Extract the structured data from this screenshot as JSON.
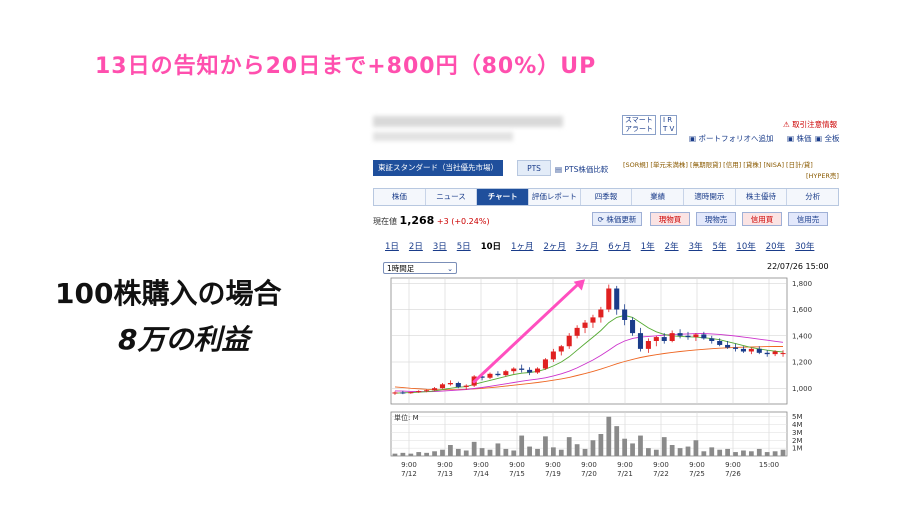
{
  "headline": "13日の告知から20日まで+800円（80%）UP",
  "caption1": "100株購入の場合",
  "caption2": "8万の利益",
  "toolbar": {
    "smart_alert": "スマート",
    "smart_alert2": "アラート",
    "ir": "I R",
    "tv": "T V",
    "risk_info": "取引注意情報",
    "portfolio_add": "ポートフォリオへ追加",
    "stock_board": "株価",
    "full_board": "全板"
  },
  "market": {
    "label": "東証スタンダード（当社優先市場）",
    "pts": "PTS",
    "pts_compare": "PTS株価比較",
    "badges_line1": "[SOR規] [単元未満株] [無期限貸] [信用] [貸株] [NISA] [日計/貸]",
    "badges_line2": "[HYPER売]"
  },
  "nav_tabs": [
    "株価",
    "ニュース",
    "チャート",
    "評価レポート",
    "四季報",
    "業績",
    "適時開示",
    "株主優待",
    "分析"
  ],
  "active_tab": "チャート",
  "quote": {
    "label": "現在値",
    "price": "1,268",
    "change": "+3 (+0.24%)"
  },
  "action_buttons": {
    "refresh": "株価更新",
    "spot_buy": "現物買",
    "spot_sell": "現物売",
    "margin_buy": "信用買",
    "margin_sell": "信用売"
  },
  "periods": [
    "1日",
    "2日",
    "3日",
    "5日",
    "10日",
    "1ヶ月",
    "2ヶ月",
    "3ヶ月",
    "6ヶ月",
    "1年",
    "2年",
    "3年",
    "5年",
    "10年",
    "20年",
    "30年"
  ],
  "selected_period": "10日",
  "interval_select": "1時間足",
  "timestamp": "22/07/26 15:00",
  "chart_data": {
    "type": "candlestick",
    "price_axis": {
      "ticks": [
        1000,
        1200,
        1400,
        1600,
        1800
      ],
      "ylim": [
        880,
        1840
      ]
    },
    "volume_axis": {
      "unit_label": "単位: M",
      "ticks": [
        "1M",
        "2M",
        "3M",
        "4M",
        "5M"
      ],
      "ylim": [
        0,
        5.6
      ]
    },
    "x_time_labels": [
      "9:00",
      "9:00",
      "9:00",
      "9:00",
      "9:00",
      "9:00",
      "9:00",
      "9:00",
      "9:00",
      "9:00",
      "15:00"
    ],
    "x_date_labels": [
      "7/12",
      "7/13",
      "7/14",
      "7/15",
      "7/19",
      "7/20",
      "7/21",
      "7/22",
      "7/25",
      "7/26",
      ""
    ],
    "candles": [
      [
        960,
        975,
        950,
        968
      ],
      [
        968,
        980,
        955,
        962
      ],
      [
        962,
        972,
        958,
        970
      ],
      [
        970,
        985,
        965,
        978
      ],
      [
        978,
        990,
        970,
        985
      ],
      [
        985,
        1010,
        980,
        1000
      ],
      [
        1000,
        1040,
        995,
        1030
      ],
      [
        1030,
        1060,
        1020,
        1040
      ],
      [
        1040,
        1050,
        1000,
        1010
      ],
      [
        1010,
        1030,
        990,
        1020
      ],
      [
        1020,
        1100,
        1010,
        1090
      ],
      [
        1090,
        1110,
        1060,
        1080
      ],
      [
        1080,
        1120,
        1070,
        1110
      ],
      [
        1110,
        1130,
        1090,
        1100
      ],
      [
        1100,
        1140,
        1090,
        1130
      ],
      [
        1130,
        1160,
        1110,
        1150
      ],
      [
        1150,
        1180,
        1120,
        1140
      ],
      [
        1140,
        1160,
        1100,
        1120
      ],
      [
        1120,
        1160,
        1110,
        1150
      ],
      [
        1150,
        1230,
        1140,
        1220
      ],
      [
        1220,
        1300,
        1200,
        1280
      ],
      [
        1280,
        1330,
        1250,
        1320
      ],
      [
        1320,
        1420,
        1300,
        1400
      ],
      [
        1400,
        1480,
        1380,
        1460
      ],
      [
        1460,
        1520,
        1420,
        1500
      ],
      [
        1500,
        1560,
        1460,
        1540
      ],
      [
        1540,
        1620,
        1500,
        1600
      ],
      [
        1600,
        1790,
        1580,
        1760
      ],
      [
        1760,
        1780,
        1560,
        1600
      ],
      [
        1600,
        1640,
        1480,
        1520
      ],
      [
        1520,
        1540,
        1400,
        1420
      ],
      [
        1420,
        1460,
        1280,
        1300
      ],
      [
        1300,
        1380,
        1270,
        1360
      ],
      [
        1360,
        1400,
        1320,
        1390
      ],
      [
        1390,
        1420,
        1340,
        1360
      ],
      [
        1360,
        1440,
        1350,
        1420
      ],
      [
        1420,
        1450,
        1380,
        1400
      ],
      [
        1400,
        1430,
        1370,
        1390
      ],
      [
        1390,
        1420,
        1360,
        1410
      ],
      [
        1410,
        1430,
        1370,
        1380
      ],
      [
        1380,
        1400,
        1340,
        1360
      ],
      [
        1360,
        1380,
        1320,
        1330
      ],
      [
        1330,
        1360,
        1300,
        1310
      ],
      [
        1310,
        1340,
        1280,
        1300
      ],
      [
        1300,
        1320,
        1270,
        1280
      ],
      [
        1280,
        1310,
        1260,
        1300
      ],
      [
        1300,
        1320,
        1260,
        1270
      ],
      [
        1270,
        1290,
        1240,
        1260
      ],
      [
        1260,
        1290,
        1245,
        1280
      ],
      [
        1265,
        1290,
        1240,
        1268
      ]
    ],
    "ma_short": [
      962,
      965,
      967,
      970,
      974,
      980,
      990,
      1000,
      1008,
      1012,
      1030,
      1045,
      1060,
      1075,
      1090,
      1105,
      1115,
      1120,
      1128,
      1145,
      1170,
      1200,
      1240,
      1290,
      1340,
      1390,
      1440,
      1500,
      1540,
      1555,
      1540,
      1500,
      1460,
      1430,
      1410,
      1400,
      1395,
      1392,
      1390,
      1385,
      1378,
      1370,
      1355,
      1340,
      1325,
      1310,
      1300,
      1290,
      1282,
      1276
    ],
    "ma_mid": [
      980,
      978,
      976,
      975,
      974,
      975,
      978,
      982,
      986,
      990,
      998,
      1006,
      1015,
      1024,
      1034,
      1044,
      1054,
      1062,
      1070,
      1080,
      1094,
      1110,
      1130,
      1155,
      1185,
      1215,
      1250,
      1290,
      1330,
      1360,
      1380,
      1390,
      1395,
      1400,
      1405,
      1410,
      1412,
      1414,
      1416,
      1416,
      1414,
      1410,
      1404,
      1398,
      1390,
      1382,
      1374,
      1366,
      1358,
      1350
    ],
    "ma_long": [
      1010,
      1005,
      1000,
      996,
      992,
      990,
      989,
      989,
      990,
      992,
      995,
      999,
      1004,
      1010,
      1016,
      1023,
      1030,
      1037,
      1044,
      1052,
      1061,
      1071,
      1083,
      1097,
      1112,
      1128,
      1146,
      1166,
      1186,
      1204,
      1220,
      1234,
      1246,
      1256,
      1265,
      1273,
      1280,
      1286,
      1292,
      1297,
      1301,
      1305,
      1308,
      1311,
      1313,
      1315,
      1316,
      1317,
      1318,
      1318
    ],
    "volumes": [
      0.3,
      0.4,
      0.3,
      0.5,
      0.4,
      0.6,
      0.8,
      1.4,
      0.9,
      0.7,
      1.8,
      1.0,
      0.8,
      1.6,
      0.9,
      0.7,
      2.6,
      1.2,
      0.9,
      2.5,
      1.1,
      0.8,
      2.4,
      1.5,
      0.9,
      2.0,
      2.8,
      5.0,
      3.8,
      2.2,
      1.6,
      2.6,
      1.0,
      0.8,
      2.4,
      1.4,
      1.0,
      1.2,
      2.0,
      0.6,
      1.1,
      0.8,
      0.9,
      0.5,
      0.7,
      0.6,
      0.9,
      0.5,
      0.6,
      0.8
    ],
    "ma_colors": [
      "#55aa33",
      "#cc33cc",
      "#ee6622"
    ],
    "candle_up_color": "#e02020",
    "candle_down_color": "#1a3c8a",
    "annotation_arrow_color": "#ff4fbf"
  }
}
